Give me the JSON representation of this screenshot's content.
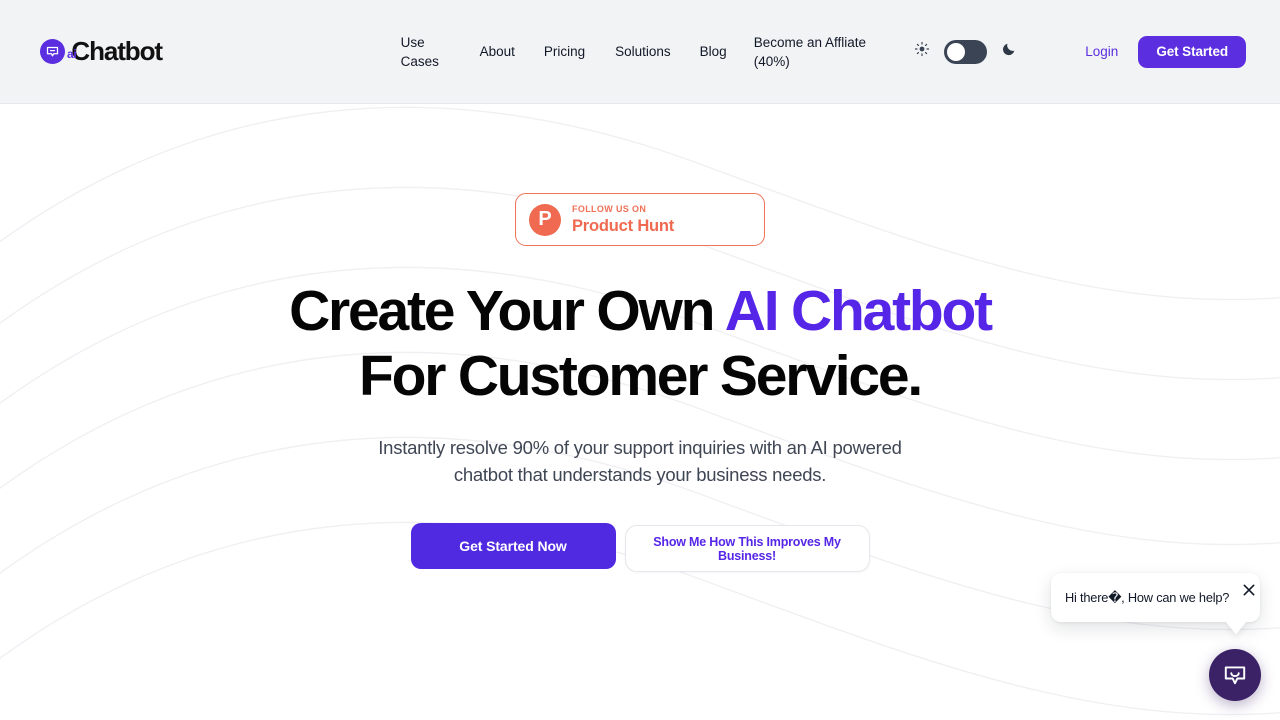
{
  "header": {
    "logo": {
      "icon": "chat-bubble-icon",
      "ai_mark": "ai",
      "word": "Chatbot"
    },
    "nav": [
      {
        "label": "Use Cases",
        "key": "use-cases"
      },
      {
        "label": "About",
        "key": "about"
      },
      {
        "label": "Pricing",
        "key": "pricing"
      },
      {
        "label": "Solutions",
        "key": "solutions"
      },
      {
        "label": "Blog",
        "key": "blog"
      },
      {
        "label": "Become an Affliate (40%)",
        "key": "affiliate"
      }
    ],
    "theme": {
      "light_icon": "sun-icon",
      "dark_icon": "moon-icon",
      "toggle_state": "off",
      "toggle_track_color": "#3b4454"
    },
    "login_label": "Login",
    "get_started_label": "Get Started",
    "background_color": "#f2f3f5"
  },
  "hero": {
    "badge": {
      "avatar_letter": "P",
      "kicker": "FOLLOW US ON",
      "title": "Product Hunt",
      "accent_color": "#ef6a50"
    },
    "headline": {
      "line1_plain": "Create Your Own ",
      "line1_accent": "AI Chatbot",
      "line2": "For Customer Service.",
      "accent_color": "#5626e8"
    },
    "subtitle": "Instantly resolve 90% of your support inquiries with an AI powered chatbot that understands your business needs.",
    "primary_cta": "Get Started Now",
    "secondary_cta": "Show Me How This Improves My Business!",
    "primary_cta_color": "#4f2ae0"
  },
  "chat_widget": {
    "greeting": "Hi there�, How can we help?",
    "close_icon": "close-icon",
    "launcher_icon": "chat-bubble-icon",
    "launcher_color": "#3b2266"
  }
}
